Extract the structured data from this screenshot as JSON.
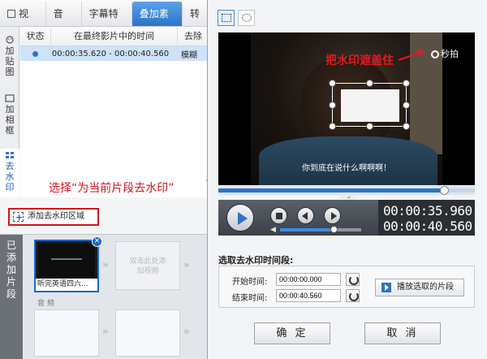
{
  "tabs": [
    {
      "label": "视 频",
      "icon": "video-icon"
    },
    {
      "label": "音 频",
      "icon": "music-icon"
    },
    {
      "label": "字幕特效",
      "icon": "subtitle-icon"
    },
    {
      "label": "叠加素材",
      "icon": "overlay-icon"
    },
    {
      "label": "转",
      "icon": "transition-icon"
    }
  ],
  "active_tab": "叠加素材",
  "side_tabs": [
    {
      "label": "加贴图",
      "icon": "sticker-icon"
    },
    {
      "label": "加相框",
      "icon": "frame-icon"
    },
    {
      "label": "去水印",
      "icon": "watermark-icon"
    }
  ],
  "list": {
    "headers": [
      "状态",
      "在最终影片中的时间",
      "去除"
    ],
    "row": {
      "time": "00:00:35.620 - 00:00:40.560",
      "type": "模糊"
    }
  },
  "instruction": "选择“为当前片段去水印”",
  "add_watermark_button": "添加去水印区域",
  "timeline": {
    "added_label": "已添加片段",
    "clip1_caption": "听完英语四六...",
    "empty_clip_text": "双击此处添加视频",
    "audio_label": "音 频"
  },
  "video": {
    "annotation": "把水印遮盖住",
    "logo": "秒拍",
    "subtitle": "你到底在说什么啊啊啊！",
    "progress": 0.88,
    "volume": 0.66
  },
  "time_display": {
    "current": "00:00:35.960",
    "total": "00:00:40.560"
  },
  "range": {
    "title": "选取去水印时间段:",
    "start_label": "开始时间:",
    "start_value": "00:00:00.000",
    "end_label": "结束时间:",
    "end_value": "00:00:40.560",
    "play_selected": "播放选取的片段"
  },
  "buttons": {
    "ok": "确 定",
    "cancel": "取 消"
  },
  "colors": {
    "accent": "#2e73c7",
    "highlight": "#d0161e"
  }
}
